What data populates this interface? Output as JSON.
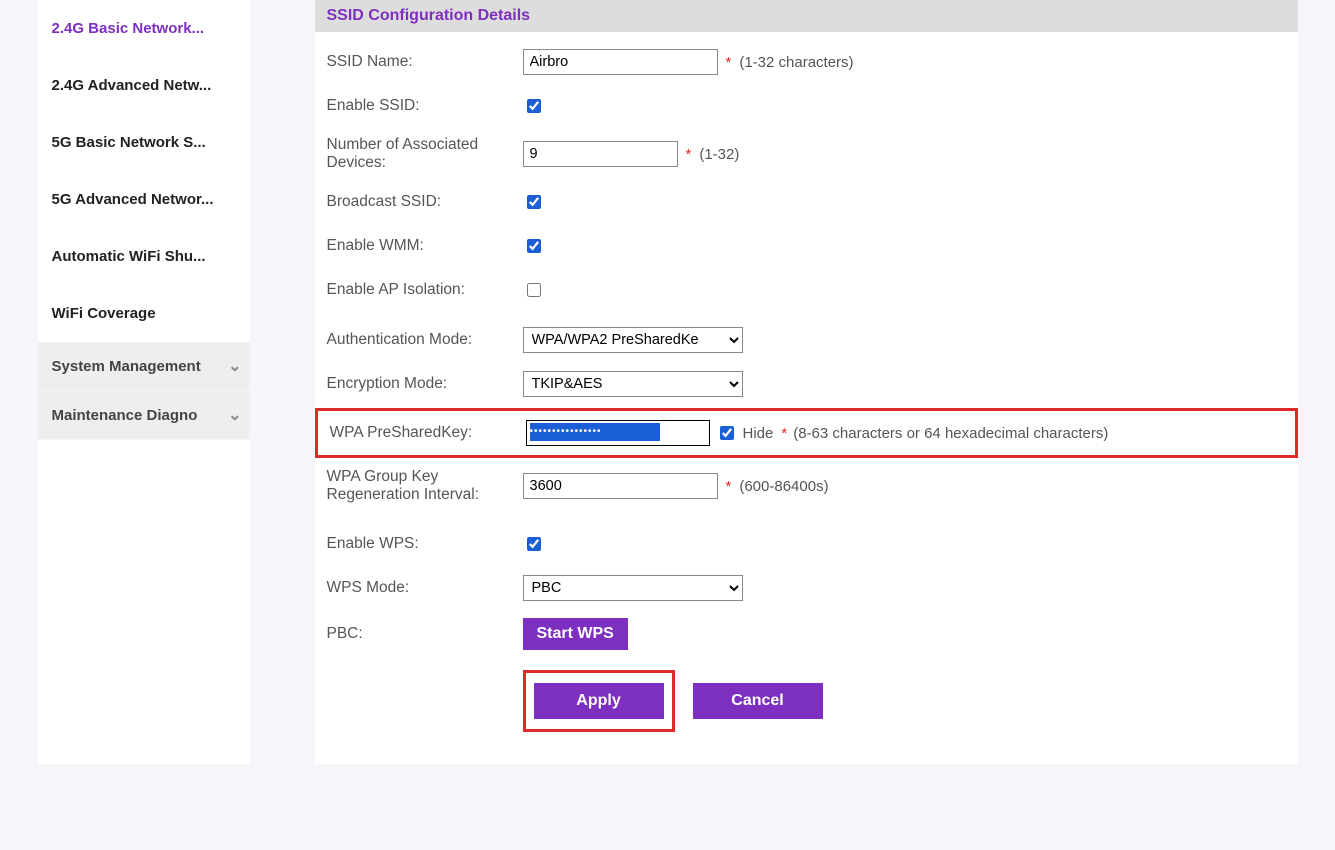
{
  "sidebar": {
    "items": [
      {
        "label": "2.4G Basic Network...",
        "active": true
      },
      {
        "label": "2.4G Advanced Netw..."
      },
      {
        "label": "5G Basic Network S..."
      },
      {
        "label": "5G Advanced Networ..."
      },
      {
        "label": "Automatic WiFi Shu..."
      },
      {
        "label": "WiFi Coverage"
      }
    ],
    "groups": [
      {
        "label": "System Management"
      },
      {
        "label": "Maintenance Diagno"
      }
    ]
  },
  "panel": {
    "title": "SSID Configuration Details"
  },
  "form": {
    "ssid_name_label": "SSID Name:",
    "ssid_name_value": "Airbro",
    "ssid_name_hint": "(1-32 characters)",
    "enable_ssid_label": "Enable SSID:",
    "enable_ssid_checked": true,
    "num_devices_label": "Number of Associated Devices:",
    "num_devices_value": "9",
    "num_devices_hint": "(1-32)",
    "broadcast_label": "Broadcast SSID:",
    "broadcast_checked": true,
    "wmm_label": "Enable WMM:",
    "wmm_checked": true,
    "ap_iso_label": "Enable AP Isolation:",
    "ap_iso_checked": false,
    "auth_mode_label": "Authentication Mode:",
    "auth_mode_value": "WPA/WPA2 PreSharedKe",
    "enc_mode_label": "Encryption Mode:",
    "enc_mode_value": "TKIP&AES",
    "psk_label": "WPA PreSharedKey:",
    "psk_masked": "••••••••••••••••",
    "hide_label": "Hide",
    "hide_checked": true,
    "psk_hint": "(8-63 characters or 64 hexadecimal characters)",
    "group_key_label": "WPA Group Key Regeneration Interval:",
    "group_key_value": "3600",
    "group_key_hint": "(600-86400s)",
    "enable_wps_label": "Enable WPS:",
    "enable_wps_checked": true,
    "wps_mode_label": "WPS Mode:",
    "wps_mode_value": "PBC",
    "pbc_label": "PBC:",
    "start_wps_label": "Start WPS",
    "apply_label": "Apply",
    "cancel_label": "Cancel"
  }
}
